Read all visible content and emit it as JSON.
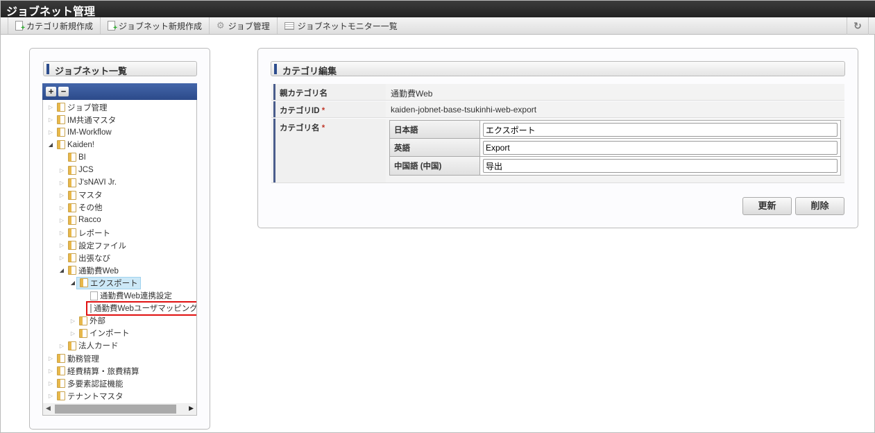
{
  "app": {
    "title": "ジョブネット管理"
  },
  "toolbar": {
    "items": [
      {
        "label": "カテゴリ新規作成",
        "icon": "new-document-icon"
      },
      {
        "label": "ジョブネット新規作成",
        "icon": "new-document-icon"
      },
      {
        "label": "ジョブ管理",
        "icon": "gear-icon"
      },
      {
        "label": "ジョブネットモニター一覧",
        "icon": "list-icon"
      }
    ],
    "refresh_icon": "refresh-icon"
  },
  "sidebar": {
    "title": "ジョブネット一覧",
    "expand_all": "+",
    "collapse_all": "−",
    "tree": [
      {
        "label": "ジョブ管理",
        "level": 0,
        "state": "closed",
        "type": "folder"
      },
      {
        "label": "IM共通マスタ",
        "level": 0,
        "state": "closed",
        "type": "folder"
      },
      {
        "label": "IM-Workflow",
        "level": 0,
        "state": "closed",
        "type": "folder"
      },
      {
        "label": "Kaiden!",
        "level": 0,
        "state": "open",
        "type": "folder"
      },
      {
        "label": "BI",
        "level": 1,
        "state": "leaf",
        "type": "folder"
      },
      {
        "label": "JCS",
        "level": 1,
        "state": "closed",
        "type": "folder"
      },
      {
        "label": "J'sNAVI Jr.",
        "level": 1,
        "state": "closed",
        "type": "folder"
      },
      {
        "label": "マスタ",
        "level": 1,
        "state": "closed",
        "type": "folder"
      },
      {
        "label": "その他",
        "level": 1,
        "state": "closed",
        "type": "folder"
      },
      {
        "label": "Racco",
        "level": 1,
        "state": "closed",
        "type": "folder"
      },
      {
        "label": "レポート",
        "level": 1,
        "state": "closed",
        "type": "folder"
      },
      {
        "label": "設定ファイル",
        "level": 1,
        "state": "closed",
        "type": "folder"
      },
      {
        "label": "出張なび",
        "level": 1,
        "state": "closed",
        "type": "folder"
      },
      {
        "label": "通勤費Web",
        "level": 1,
        "state": "open",
        "type": "folder"
      },
      {
        "label": "エクスポート",
        "level": 2,
        "state": "open",
        "type": "folder",
        "selected": true
      },
      {
        "label": "通勤費Web連携設定",
        "level": 3,
        "state": "leaf",
        "type": "file"
      },
      {
        "label": "通勤費Webユーザマッピング",
        "level": 3,
        "state": "leaf",
        "type": "file",
        "highlighted": true
      },
      {
        "label": "外部",
        "level": 2,
        "state": "closed",
        "type": "folder"
      },
      {
        "label": "インポート",
        "level": 2,
        "state": "closed",
        "type": "folder"
      },
      {
        "label": "法人カード",
        "level": 1,
        "state": "closed",
        "type": "folder"
      },
      {
        "label": "勤務管理",
        "level": 0,
        "state": "closed",
        "type": "folder"
      },
      {
        "label": "経費精算・旅費精算",
        "level": 0,
        "state": "closed",
        "type": "folder"
      },
      {
        "label": "多要素認証機能",
        "level": 0,
        "state": "closed",
        "type": "folder"
      },
      {
        "label": "テナントマスタ",
        "level": 0,
        "state": "closed",
        "type": "folder"
      }
    ]
  },
  "main": {
    "title": "カテゴリ編集",
    "parent_label": "親カテゴリ名",
    "parent_value": "通勤費Web",
    "id_label": "カテゴリID",
    "id_value": "kaiden-jobnet-base-tsukinhi-web-export",
    "name_label": "カテゴリ名",
    "required_mark": "*",
    "names": [
      {
        "lang": "日本語",
        "value": "エクスポート"
      },
      {
        "lang": "英語",
        "value": "Export"
      },
      {
        "lang": "中国語 (中国)",
        "value": "导出"
      }
    ],
    "update_button": "更新",
    "delete_button": "削除"
  },
  "colors": {
    "accent": "#2d4d8e",
    "highlight": "#e01010",
    "selection": "#cce8f7"
  }
}
